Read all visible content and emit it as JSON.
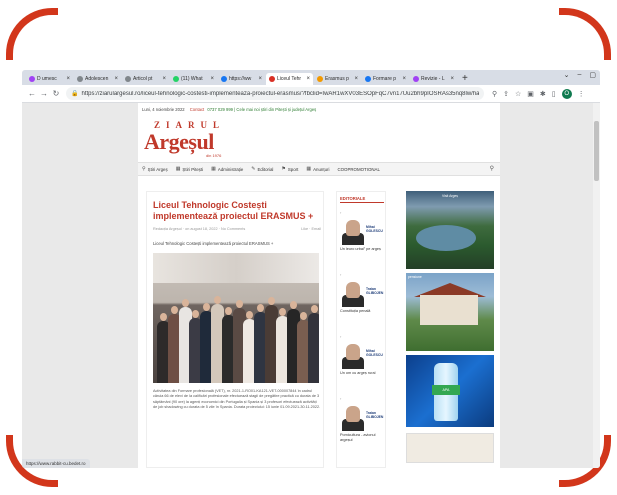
{
  "browser": {
    "tabs": [
      {
        "label": "D umesc",
        "color": "#a142f4",
        "active": false
      },
      {
        "label": "Adolescen",
        "color": "#80868b",
        "active": false
      },
      {
        "label": "Articol pt",
        "color": "#80868b",
        "active": false
      },
      {
        "label": "(11) What",
        "color": "#25d366",
        "active": false
      },
      {
        "label": "https://ww",
        "color": "#1877f2",
        "active": false
      },
      {
        "label": "Liceul Tehr",
        "color": "#d93025",
        "active": true
      },
      {
        "label": "Erasmus p",
        "color": "#f29900",
        "active": false
      },
      {
        "label": "Formare p",
        "color": "#1877f2",
        "active": false
      },
      {
        "label": "Revizie - L",
        "color": "#a142f4",
        "active": false
      }
    ],
    "close_glyph": "×",
    "new_tab_glyph": "+",
    "url": "https://ziarulargesul.ro/liceul-tehnologic-costesti-implementeaza-proiectul-erasmus/?fbclid=IwAR1wXV03ESOpFqC7vn17Uu2bh9pIOSRAs35nq8lw/hao...",
    "profile_initial": "O",
    "status_text": "https://www.rabbit-cu.bedet.ro"
  },
  "site": {
    "date_line": "Luni, 4 noiembrie 2022",
    "contact_label": "Contact",
    "contact_phone": "0737 029 999 | Cele mai noi știri din Pitești și județul Argeș",
    "logo_small": "ZIARUL",
    "logo_big": "Argeșul",
    "logo_year": "din 1976",
    "menu": [
      {
        "icon": "⚲",
        "label": "Știri Argeș"
      },
      {
        "icon": "▦",
        "label": "Știri Pitești"
      },
      {
        "icon": "▦",
        "label": "Administrație"
      },
      {
        "icon": "✎",
        "label": "Editorial"
      },
      {
        "icon": "⚑",
        "label": "Sport"
      },
      {
        "icon": "▦",
        "label": "Anunțuri"
      },
      {
        "icon": "",
        "label": "COOPROMOTIONAL"
      }
    ]
  },
  "article": {
    "title": "Liceul Tehnologic Costești implementează proiectul ERASMUS +",
    "author_date": "Redacția Argeșul · on august 18, 2022 · No Comments",
    "meta_right": "Like · Email",
    "lead": "Liceul Tehnologic Costești implementează proiectul ERASMUS +",
    "body": "Activitatea din Formare profesională (VET), nr. 2021-1-RO01-KA121-VET-000007844 în cadrul căruia 66 de elevi de la calificări profesionale efectuează stagii de pregătire practică cu durata de 3 săptămâni (90 ore) la agenți economici din Portugalia și Spania și 3 profesori efectuează activități de job shadowing cu durata de 5 zile în Spania. Durata proiectului: 15 iunie 01.09.2021-30.11.2022."
  },
  "editorials": {
    "heading": "EDITORIALE",
    "items": [
      {
        "author_tag": "Mihai GOLESCU",
        "caption": "Un leuro urbal” pe argeș"
      },
      {
        "author_tag": "Traian GLIBOJEN",
        "caption": "Constituția penală"
      },
      {
        "author_tag": "Mihai GOLESCU",
        "caption": "Un om cu argeș rural"
      },
      {
        "author_tag": "Traian GLIBOJEN",
        "caption": "Pomicultura - avionul argeșul"
      }
    ]
  },
  "ads": {
    "ad1_title": "Visit Argeș",
    "ad2_tagline": "pensiune",
    "ad3_label": "APA"
  }
}
